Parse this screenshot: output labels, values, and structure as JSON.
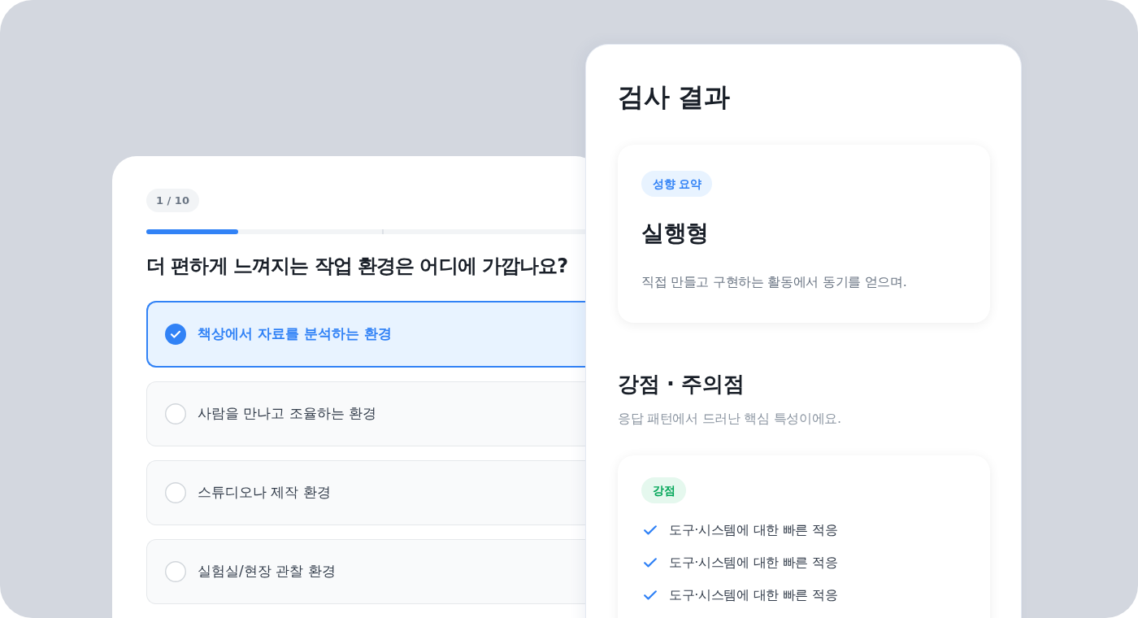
{
  "quiz_card": {
    "progress_badge": "1 / 10",
    "progress": {
      "level": 0.21
    },
    "question": "더 편하게 느껴지는 작업 환경은 어디에 가깝나요?",
    "options": [
      {
        "label": "책상에서 자료를 분석하는 환경",
        "selected": true
      },
      {
        "label": "사람을 만나고 조율하는 환경",
        "selected": false
      },
      {
        "label": "스튜디오나 제작 환경",
        "selected": false
      },
      {
        "label": "실험실/현장 관찰 환경",
        "selected": false
      }
    ]
  },
  "result_panel": {
    "title": "검사 결과",
    "summary_card": {
      "badge": "성향 요약",
      "type_name": "실행형",
      "description": "직접 만들고 구현하는 활동에서 동기를 얻으며."
    },
    "section": {
      "title": "강점 · 주의점",
      "subtitle": "응답 패턴에서 드러난 핵심 특성이에요."
    },
    "strengths_card": {
      "badge": "강점",
      "items": [
        "도구·시스템에 대한 빠른 적응",
        "도구·시스템에 대한 빠른 적응",
        "도구·시스템에 대한 빠른 적응"
      ]
    }
  }
}
